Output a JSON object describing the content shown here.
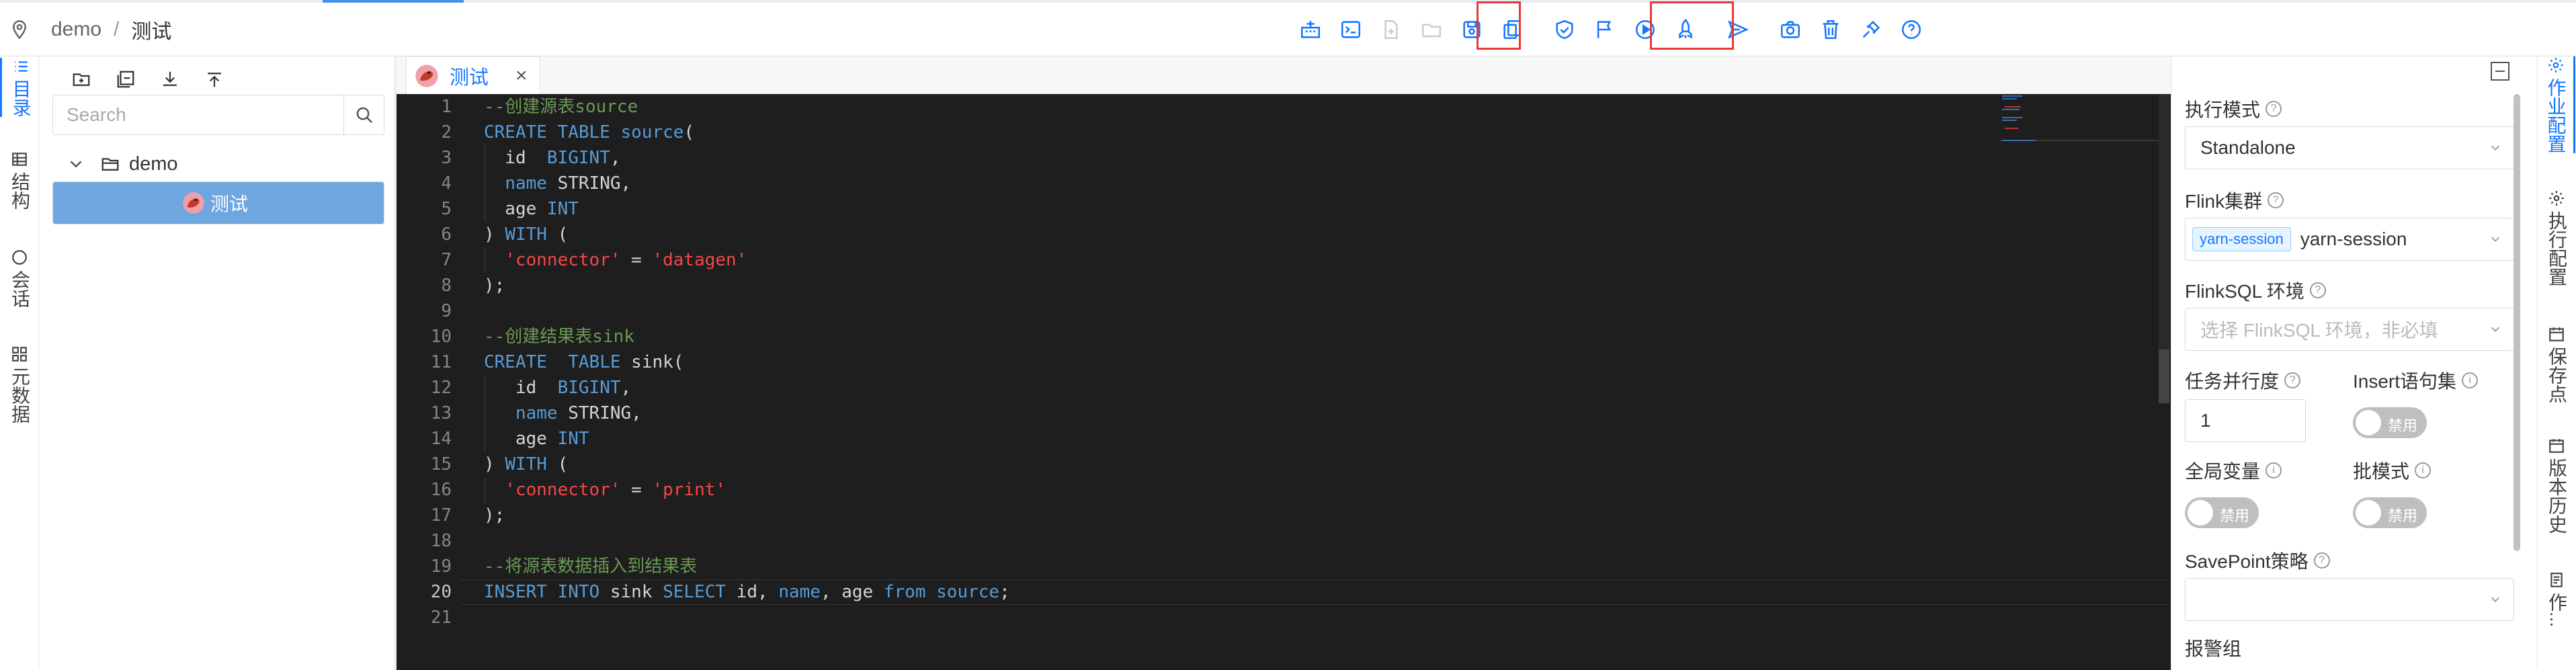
{
  "breadcrumb": {
    "project": "demo",
    "separator": "/",
    "current": "测试"
  },
  "toolbar": {
    "icons": [
      "cluster-icon",
      "console-icon",
      "new-file-icon",
      "open-file-icon",
      "save-icon",
      "copy-icon",
      "check-icon",
      "flag-icon",
      "run-icon",
      "publish-icon",
      "send-icon",
      "camera-icon",
      "delete-icon",
      "plug-icon",
      "help-icon"
    ],
    "highlighted": [
      "save-icon",
      "run-icon",
      "publish-icon"
    ]
  },
  "left_rail": [
    {
      "label": "目录",
      "icon": "list-icon",
      "active": true
    },
    {
      "label": "结构",
      "icon": "table-icon",
      "active": false
    },
    {
      "label": "会话",
      "icon": "chat-icon",
      "active": false
    },
    {
      "label": "元数据",
      "icon": "grid-icon",
      "active": false
    }
  ],
  "tree": {
    "search_placeholder": "Search",
    "folder": "demo",
    "file": "测试"
  },
  "editor": {
    "tab_label": "测试",
    "close": "×",
    "line_numbers": [
      "1",
      "2",
      "3",
      "4",
      "5",
      "6",
      "7",
      "8",
      "9",
      "10",
      "11",
      "12",
      "13",
      "14",
      "15",
      "16",
      "17",
      "18",
      "19",
      "20",
      "21"
    ],
    "current_line": "20"
  },
  "right_panel": {
    "exec_mode_label": "执行模式",
    "exec_mode_value": "Standalone",
    "cluster_label": "Flink集群",
    "cluster_tag": "yarn-session",
    "cluster_value": "yarn-session",
    "env_label": "FlinkSQL 环境",
    "env_placeholder": "选择 FlinkSQL 环境，非必填",
    "parallelism_label": "任务并行度",
    "parallelism_value": "1",
    "insert_label": "Insert语句集",
    "insert_toggle": "禁用",
    "global_var_label": "全局变量",
    "global_var_toggle": "禁用",
    "batch_label": "批模式",
    "batch_toggle": "禁用",
    "savepoint_label": "SavePoint策略",
    "alert_label": "报警组"
  },
  "right_rail": [
    {
      "label": "作业配置",
      "icon": "settings-icon",
      "active": true
    },
    {
      "label": "执行配置",
      "icon": "settings-icon",
      "active": false
    },
    {
      "label": "保存点",
      "icon": "calendar-icon",
      "active": false
    },
    {
      "label": "版本历史",
      "icon": "calendar-icon",
      "active": false
    },
    {
      "label": "作...",
      "icon": "doc-icon",
      "active": false
    }
  ]
}
